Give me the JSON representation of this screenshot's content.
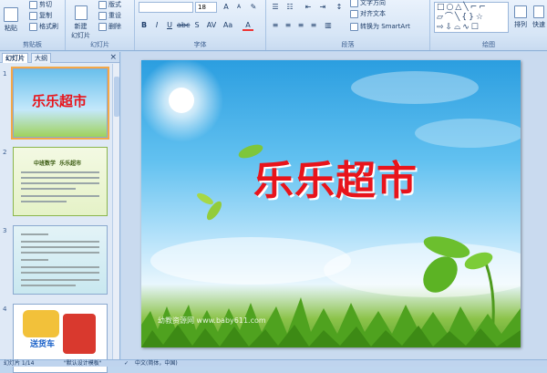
{
  "ribbon": {
    "groups": {
      "clipboard": {
        "label": "剪贴板",
        "paste": "粘贴",
        "cut": "剪切",
        "copy": "复制",
        "format_painter": "格式刷"
      },
      "slides": {
        "label": "幻灯片",
        "new_slide": "新建\n幻灯片",
        "layout": "版式",
        "reset": "重设",
        "delete": "删除"
      },
      "font": {
        "label": "字体",
        "font_name": "",
        "font_size": "18"
      },
      "paragraph": {
        "label": "段落",
        "text_direction": "文字方向",
        "align_text": "对齐文本",
        "smartart": "转换为 SmartArt"
      },
      "drawing": {
        "label": "绘图",
        "arrange": "排列",
        "quick_styles": "快速"
      }
    }
  },
  "panel": {
    "tabs": [
      {
        "label": "幻灯片"
      },
      {
        "label": "大纲"
      }
    ],
    "close": "×",
    "thumbnails": [
      {
        "num": "1",
        "text": "乐乐超市"
      },
      {
        "num": "2",
        "text": "中班数学  乐乐超市"
      },
      {
        "num": "3",
        "text": ""
      },
      {
        "num": "4",
        "text": "送货车"
      }
    ]
  },
  "slide": {
    "title": "乐乐超市",
    "watermark": "幼教资源网 www.baby611.com"
  },
  "status": {
    "slide_count": "幻灯片 1/14",
    "theme": "\"默认设计模板\"",
    "language": "中文(简体，中国)"
  },
  "colors": {
    "title": "#e8141b",
    "ribbon_bg": "#d6e5f6",
    "selection": "#f4a847"
  }
}
